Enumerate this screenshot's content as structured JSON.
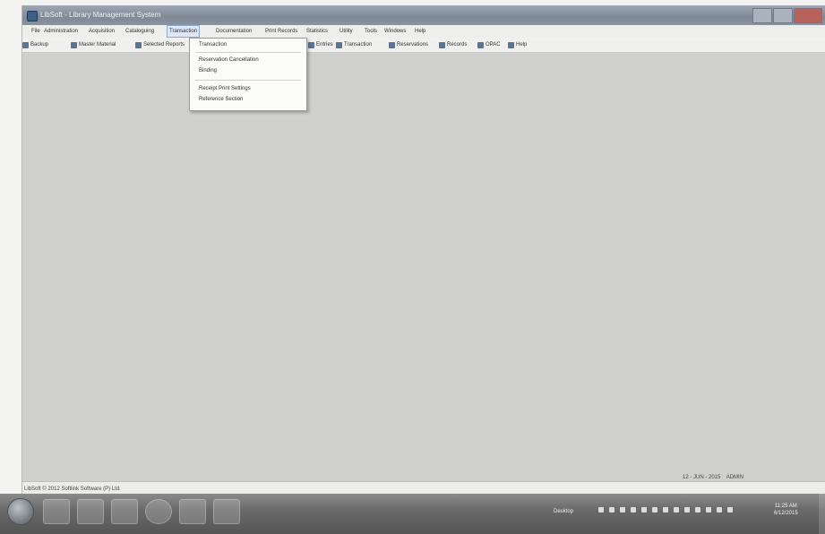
{
  "window": {
    "title": "LibSoft - Library Management System"
  },
  "menu": {
    "items": [
      {
        "label": "File"
      },
      {
        "label": "Administration"
      },
      {
        "label": "Acquisition"
      },
      {
        "label": "Cataloguing"
      },
      {
        "label": "Transaction"
      },
      {
        "label": "Documentation"
      },
      {
        "label": "Print Records"
      },
      {
        "label": "Statistics"
      },
      {
        "label": "Utility"
      },
      {
        "label": "Tools"
      },
      {
        "label": "Windows"
      },
      {
        "label": "Help"
      }
    ],
    "active": "Transaction"
  },
  "toolbar": {
    "items": [
      {
        "label": "Backup"
      },
      {
        "label": "Master Material"
      },
      {
        "label": "Selected Reports"
      },
      {
        "label": "Entries"
      },
      {
        "label": "Transaction"
      },
      {
        "label": "Reservations"
      },
      {
        "label": "Records"
      },
      {
        "label": "OPAC"
      },
      {
        "label": "Help"
      }
    ]
  },
  "dropdown": {
    "items": [
      {
        "label": "Transaction"
      },
      {
        "label": "Reservation Cancellation"
      },
      {
        "label": "Binding"
      },
      {
        "label": "Receipt Print Settings"
      },
      {
        "label": "Reference Section"
      }
    ]
  },
  "statusbar": {
    "text": "LibSoft © 2012 Softlink Software (P) Ltd."
  },
  "taskbar": {
    "language": "Desktop",
    "date_left": "12 - JUN - 2015",
    "user": "ADMIN",
    "clock_time": "11:25 AM",
    "clock_date": "6/12/2015"
  }
}
